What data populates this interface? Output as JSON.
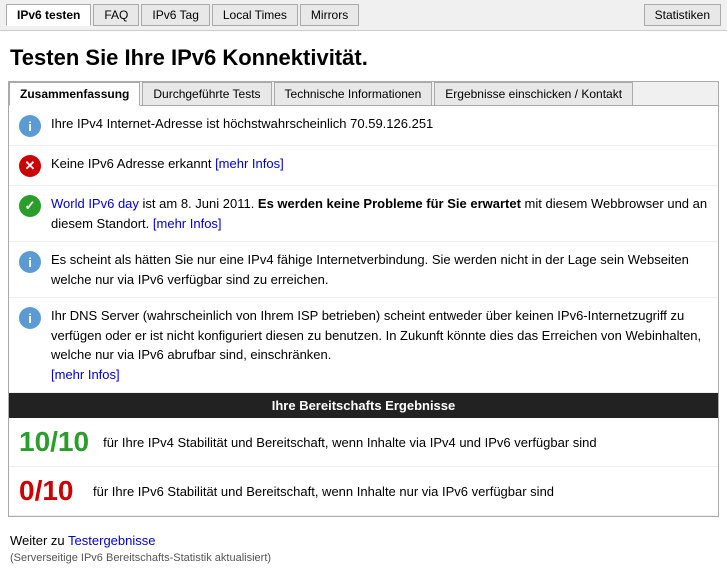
{
  "nav": {
    "tabs": [
      {
        "label": "IPv6 testen",
        "active": true
      },
      {
        "label": "FAQ",
        "active": false
      },
      {
        "label": "IPv6 Tag",
        "active": false
      },
      {
        "label": "Local Times",
        "active": false
      },
      {
        "label": "Mirrors",
        "active": false
      }
    ],
    "right_button": "Statistiken"
  },
  "page_title": "Testen Sie Ihre IPv6 Konnektivität.",
  "sub_tabs": [
    {
      "label": "Zusammenfassung",
      "active": true
    },
    {
      "label": "Durchgeführte Tests",
      "active": false
    },
    {
      "label": "Technische Informationen",
      "active": false
    },
    {
      "label": "Ergebnisse einschicken / Kontakt",
      "active": false
    }
  ],
  "info_rows": [
    {
      "icon": "info",
      "icon_type": "blue",
      "text": "Ihre IPv4 Internet-Adresse ist höchstwahrscheinlich 70.59.126.251",
      "has_link": false
    },
    {
      "icon": "x",
      "icon_type": "red",
      "text": "Keine IPv6 Adresse erkannt",
      "link_text": "[mehr Infos]",
      "has_link": true
    },
    {
      "icon": "check",
      "icon_type": "green",
      "text_prefix": "",
      "link_text": "World IPv6 day",
      "text_middle": " ist am 8. Juni 2011. ",
      "text_bold": "Es werden keine Probleme für Sie erwartet",
      "text_suffix": " mit diesem Webbrowser und an diesem Standort.",
      "link2_text": "[mehr Infos]",
      "has_link": true,
      "type": "world"
    },
    {
      "icon": "info",
      "icon_type": "blue",
      "text": "Es scheint als hätten Sie nur eine IPv4 fähige Internetverbindung. Sie werden nicht in der Lage sein Webseiten welche nur via IPv6 verfügbar sind zu erreichen.",
      "has_link": false
    },
    {
      "icon": "info",
      "icon_type": "blue",
      "text": "Ihr DNS Server (wahrscheinlich von Ihrem ISP betrieben) scheint entweder über keinen IPv6-Internetzugriff zu verfügen oder er ist nicht konfiguriert diesen zu benutzen. In Zukunft könnte dies das Erreichen von Webinhalten, welche nur via IPv6 abrufbar sind, einschränken.",
      "link_text": "[mehr Infos]",
      "has_link": true,
      "link_below": true
    }
  ],
  "results_header": "Ihre Bereitschafts Ergebnisse",
  "scores": [
    {
      "score": "10/10",
      "color": "green",
      "desc": "für Ihre IPv4 Stabilität und Bereitschaft, wenn Inhalte via IPv4 und IPv6 verfügbar sind"
    },
    {
      "score": "0/10",
      "color": "red",
      "desc": "für Ihre IPv6 Stabilität und Bereitschaft, wenn Inhalte nur via IPv6 verfügbar sind"
    }
  ],
  "footer": {
    "prefix": "Weiter zu ",
    "link_text": "Testergebnisse",
    "note": "(Serverseitige IPv6 Bereitschafts-Statistik aktualisiert)"
  }
}
